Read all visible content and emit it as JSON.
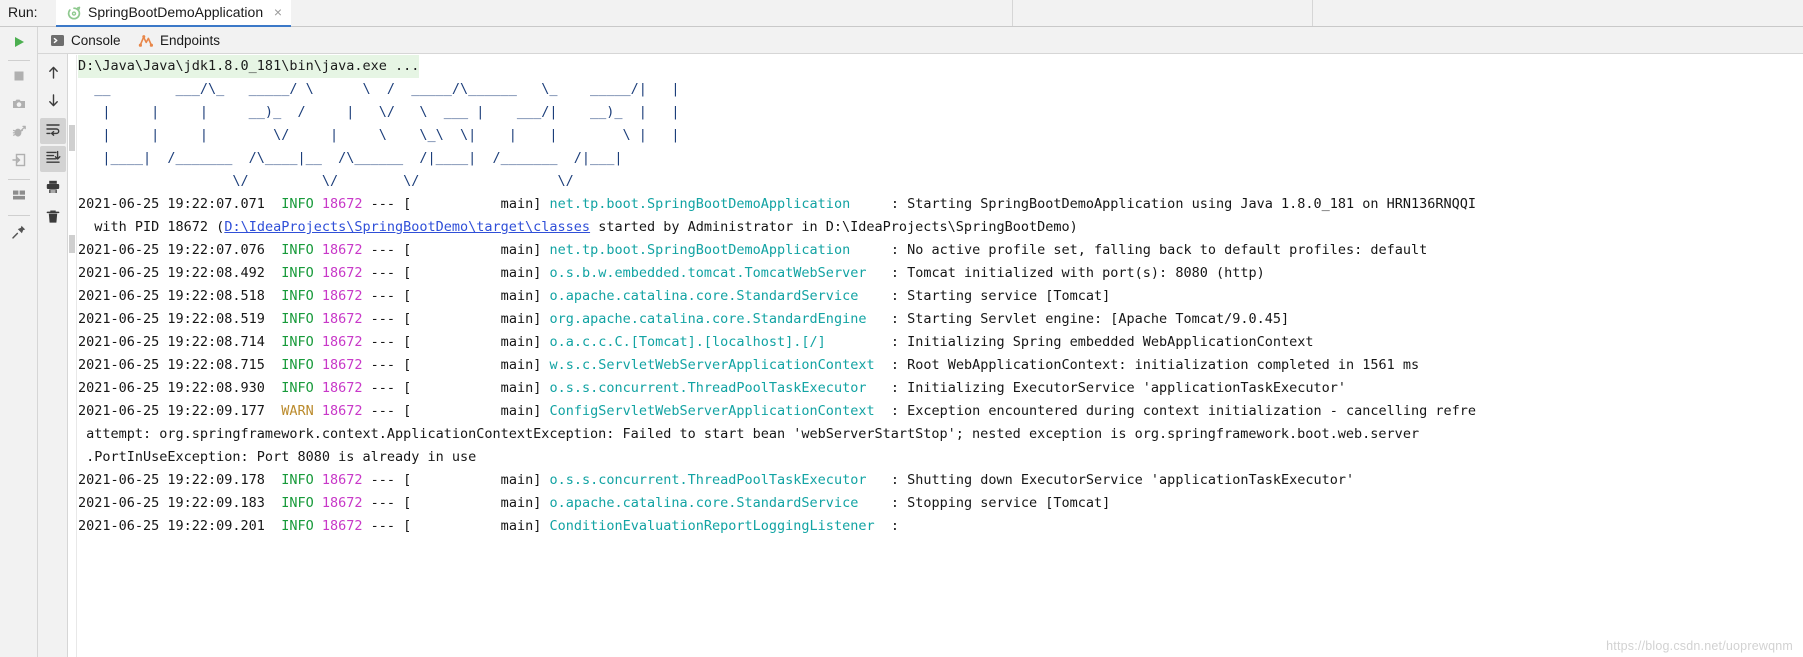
{
  "window": {
    "run_label": "Run:",
    "run_tab_title": "SpringBootDemoApplication",
    "close_glyph": "×"
  },
  "left_toolbar": {
    "items": [
      {
        "name": "rerun-button",
        "icon": "play-icon"
      },
      {
        "name": "stop-button",
        "icon": "stop-icon"
      },
      {
        "name": "screenshot-button",
        "icon": "camera-icon"
      },
      {
        "name": "debug-button",
        "icon": "bug-icon"
      },
      {
        "name": "export-button",
        "icon": "export-icon"
      },
      {
        "name": "layout-button",
        "icon": "layout-icon"
      },
      {
        "name": "pin-button",
        "icon": "pin-icon"
      }
    ]
  },
  "console_toolbar": {
    "items": [
      {
        "name": "scroll-up-button",
        "icon": "arrow-up-icon",
        "active": false
      },
      {
        "name": "scroll-down-button",
        "icon": "arrow-down-icon",
        "active": false
      },
      {
        "name": "soft-wrap-button",
        "icon": "wrap-icon",
        "active": true
      },
      {
        "name": "scroll-to-end-button",
        "icon": "scroll-end-icon",
        "active": true
      },
      {
        "name": "print-button",
        "icon": "printer-icon",
        "active": false
      },
      {
        "name": "clear-all-button",
        "icon": "trash-icon",
        "active": false
      }
    ]
  },
  "tabs": [
    {
      "label": "Console",
      "icon": "console-icon",
      "selected": true
    },
    {
      "label": "Endpoints",
      "icon": "endpoints-icon",
      "selected": false
    }
  ],
  "console": {
    "command_line": "D:\\Java\\Java\\jdk1.8.0_181\\bin\\java.exe ...",
    "banner": [
      "  __        ___/\\_   _____/ \\      \\  /  _____/\\______   \\_    _____/|   |",
      "   |     |     |     __)_  /     |   \\/   \\  ___ |    ___/|    __)_  |   |",
      "   |     |     |        \\/     |     \\    \\_\\  \\|    |    |        \\ |   |",
      "   |____|  /_______  /\\____|__  /\\______  /|____|  /_______  /|___|",
      "                   \\/         \\/        \\/                 \\/"
    ],
    "log_lines": [
      {
        "type": "log",
        "timestamp": "2021-06-25 19:22:07.071",
        "level": "INFO",
        "pid": "18672",
        "sep": "--- [",
        "thread": "           main]",
        "logger": "net.tp.boot.SpringBootDemoApplication",
        "logger_pad": "     ",
        "message": ": Starting SpringBootDemoApplication using Java 1.8.0_181 on HRN136RNQQI"
      },
      {
        "type": "cont_link",
        "prefix": "  with PID 18672 (",
        "link": "D:\\IdeaProjects\\SpringBootDemo\\target\\classes",
        "suffix": " started by Administrator in D:\\IdeaProjects\\SpringBootDemo)"
      },
      {
        "type": "log",
        "timestamp": "2021-06-25 19:22:07.076",
        "level": "INFO",
        "pid": "18672",
        "sep": "--- [",
        "thread": "           main]",
        "logger": "net.tp.boot.SpringBootDemoApplication",
        "logger_pad": "     ",
        "message": ": No active profile set, falling back to default profiles: default"
      },
      {
        "type": "log",
        "timestamp": "2021-06-25 19:22:08.492",
        "level": "INFO",
        "pid": "18672",
        "sep": "--- [",
        "thread": "           main]",
        "logger": "o.s.b.w.embedded.tomcat.TomcatWebServer",
        "logger_pad": "   ",
        "message": ": Tomcat initialized with port(s): 8080 (http)"
      },
      {
        "type": "log",
        "timestamp": "2021-06-25 19:22:08.518",
        "level": "INFO",
        "pid": "18672",
        "sep": "--- [",
        "thread": "           main]",
        "logger": "o.apache.catalina.core.StandardService",
        "logger_pad": "    ",
        "message": ": Starting service [Tomcat]"
      },
      {
        "type": "log",
        "timestamp": "2021-06-25 19:22:08.519",
        "level": "INFO",
        "pid": "18672",
        "sep": "--- [",
        "thread": "           main]",
        "logger": "org.apache.catalina.core.StandardEngine",
        "logger_pad": "   ",
        "message": ": Starting Servlet engine: [Apache Tomcat/9.0.45]"
      },
      {
        "type": "log",
        "timestamp": "2021-06-25 19:22:08.714",
        "level": "INFO",
        "pid": "18672",
        "sep": "--- [",
        "thread": "           main]",
        "logger": "o.a.c.c.C.[Tomcat].[localhost].[/]",
        "logger_pad": "        ",
        "message": ": Initializing Spring embedded WebApplicationContext"
      },
      {
        "type": "log",
        "timestamp": "2021-06-25 19:22:08.715",
        "level": "INFO",
        "pid": "18672",
        "sep": "--- [",
        "thread": "           main]",
        "logger": "w.s.c.ServletWebServerApplicationContext",
        "logger_pad": "  ",
        "message": ": Root WebApplicationContext: initialization completed in 1561 ms"
      },
      {
        "type": "log",
        "timestamp": "2021-06-25 19:22:08.930",
        "level": "INFO",
        "pid": "18672",
        "sep": "--- [",
        "thread": "           main]",
        "logger": "o.s.s.concurrent.ThreadPoolTaskExecutor",
        "logger_pad": "   ",
        "message": ": Initializing ExecutorService 'applicationTaskExecutor'"
      },
      {
        "type": "log",
        "timestamp": "2021-06-25 19:22:09.177",
        "level": "WARN",
        "pid": "18672",
        "sep": "--- [",
        "thread": "           main]",
        "logger": "ConfigServletWebServerApplicationContext",
        "logger_pad": "  ",
        "message": ": Exception encountered during context initialization - cancelling refre"
      },
      {
        "type": "cont",
        "text": " attempt: org.springframework.context.ApplicationContextException: Failed to start bean 'webServerStartStop'; nested exception is org.springframework.boot.web.server"
      },
      {
        "type": "cont",
        "text": " .PortInUseException: Port 8080 is already in use"
      },
      {
        "type": "log",
        "timestamp": "2021-06-25 19:22:09.178",
        "level": "INFO",
        "pid": "18672",
        "sep": "--- [",
        "thread": "           main]",
        "logger": "o.s.s.concurrent.ThreadPoolTaskExecutor",
        "logger_pad": "   ",
        "message": ": Shutting down ExecutorService 'applicationTaskExecutor'"
      },
      {
        "type": "log",
        "timestamp": "2021-06-25 19:22:09.183",
        "level": "INFO",
        "pid": "18672",
        "sep": "--- [",
        "thread": "           main]",
        "logger": "o.apache.catalina.core.StandardService",
        "logger_pad": "    ",
        "message": ": Stopping service [Tomcat]"
      },
      {
        "type": "log",
        "timestamp": "2021-06-25 19:22:09.201",
        "level": "INFO",
        "pid": "18672",
        "sep": "--- [",
        "thread": "           main]",
        "logger": "ConditionEvaluationReportLoggingListener",
        "logger_pad": "  ",
        "message": ":"
      }
    ]
  },
  "watermark": "https://blog.csdn.net/uoprewqnm",
  "colors": {
    "accent_tab_underline": "#3c79c8",
    "info": "#179a3a",
    "warn": "#bb8b2c",
    "pid": "#c838c8",
    "logger": "#12a3a3",
    "link": "#2f4fd8",
    "command_bg": "#e6f5e4",
    "banner": "#1c3e7a",
    "chrome_bg": "#f2f2f2"
  }
}
